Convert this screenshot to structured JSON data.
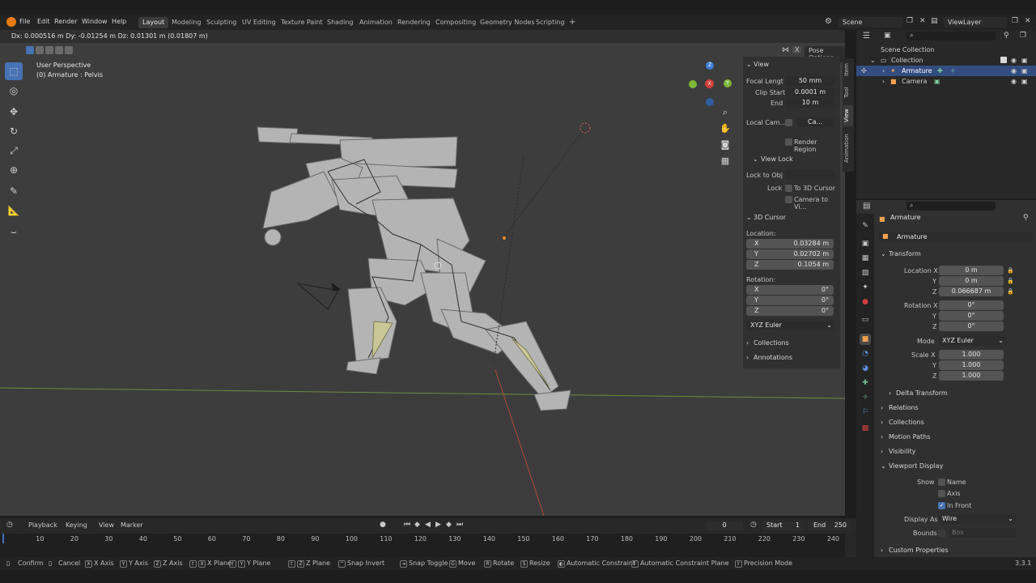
{
  "menu": [
    "File",
    "Edit",
    "Render",
    "Window",
    "Help"
  ],
  "workspaces": [
    "Layout",
    "Modeling",
    "Sculpting",
    "UV Editing",
    "Texture Paint",
    "Shading",
    "Animation",
    "Rendering",
    "Compositing",
    "Geometry Nodes",
    "Scripting"
  ],
  "active_workspace": "Layout",
  "add_tab_label": "+",
  "scene": {
    "label": "Scene",
    "viewlayer": "ViewLayer"
  },
  "viewport": {
    "delta_readout": "Dx: 0.000516 m  Dy: -0.01254 m  Dz: 0.01301 m (0.01807 m)",
    "perspective": "User Perspective",
    "object_info": "(0) Armature : Pelvis",
    "pose_options": "Pose Options",
    "close_x": "X",
    "gizmo": {
      "x": "X",
      "y": "Y",
      "z": "Z"
    }
  },
  "npanel": {
    "tabs": [
      "Item",
      "Tool",
      "View",
      "Animation"
    ],
    "view": {
      "title": "View",
      "focal_label": "Focal Lengt",
      "focal_value": "50 mm",
      "clip_start_label": "Clip Start",
      "clip_start_value": "0.0001 m",
      "end_label": "End",
      "end_value": "10 m",
      "local_camera_label": "Local Cam...",
      "local_camera_value": "Ca...",
      "render_region": "Render Region"
    },
    "view_lock": {
      "title": "View Lock",
      "lock_obj_label": "Lock to Obj",
      "lock_label": "Lock",
      "to_cursor": "To 3D Cursor",
      "camera_to_view": "Camera to Vi..."
    },
    "cursor": {
      "title": "3D Cursor",
      "location_label": "Location:",
      "x": "0.03284 m",
      "y": "0.02702 m",
      "z": "0.1054 m",
      "rotation_label": "Rotation:",
      "rx": "0°",
      "ry": "0°",
      "rz": "0°",
      "mode": "XYZ Euler",
      "axis_x": "X",
      "axis_y": "Y",
      "axis_z": "Z"
    },
    "collections": "Collections",
    "annotations": "Annotations"
  },
  "outliner": {
    "rows": [
      {
        "label": "Scene Collection"
      },
      {
        "label": "Collection"
      },
      {
        "label": "Armature"
      },
      {
        "label": "Camera"
      }
    ]
  },
  "properties": {
    "object_name": "Armature",
    "data_name": "Armature",
    "transform": {
      "title": "Transform",
      "location_label": "Location X",
      "lx": "0 m",
      "ly": "0 m",
      "lz": "0.066687 m",
      "rotation_label": "Rotation X",
      "rx": "0°",
      "ry": "0°",
      "rz": "0°",
      "mode_label": "Mode",
      "mode": "XYZ Euler",
      "scale_label": "Scale X",
      "sx": "1.000",
      "sy": "1.000",
      "sz": "1.000",
      "y_label": "Y",
      "z_label": "Z"
    },
    "sections": [
      "Delta Transform",
      "Relations",
      "Collections",
      "Motion Paths",
      "Visibility",
      "Viewport Display"
    ],
    "viewport_display": {
      "show_label": "Show",
      "name": "Name",
      "axis": "Axis",
      "in_front": "In Front",
      "display_as_label": "Display As",
      "display_as": "Wire",
      "bounds_label": "Bounds",
      "bounds_value": "Box"
    },
    "custom_properties": "Custom Properties"
  },
  "timeline": {
    "menus": [
      "Playback",
      "Keying",
      "View",
      "Marker"
    ],
    "current_frame": "0",
    "start_label": "Start",
    "start": "1",
    "end_label": "End",
    "end": "250",
    "ticks": [
      "10",
      "20",
      "30",
      "40",
      "50",
      "60",
      "70",
      "80",
      "90",
      "100",
      "110",
      "120",
      "130",
      "140",
      "150",
      "160",
      "170",
      "180",
      "190",
      "200",
      "210",
      "220",
      "230",
      "240"
    ]
  },
  "statusbar": {
    "items": [
      "Confirm",
      "Cancel",
      "X Axis",
      "Y Axis",
      "Z Axis",
      "X Plane",
      "Y Plane",
      "Z Plane",
      "Snap Invert",
      "Snap Toggle",
      "Move",
      "Rotate",
      "Resize",
      "Automatic Constraint",
      "Automatic Constraint Plane",
      "Precision Mode"
    ],
    "keys": [
      "X",
      "Y",
      "Z",
      "X",
      "Y",
      "Z",
      "G",
      "R",
      "S"
    ],
    "version": "3.3.1"
  },
  "colors": {
    "accent": "#4772b3",
    "x_axis": "#d0403c",
    "y_axis": "#7fb73a",
    "z_axis": "#3f80d9",
    "selected_row": "#334d80"
  }
}
